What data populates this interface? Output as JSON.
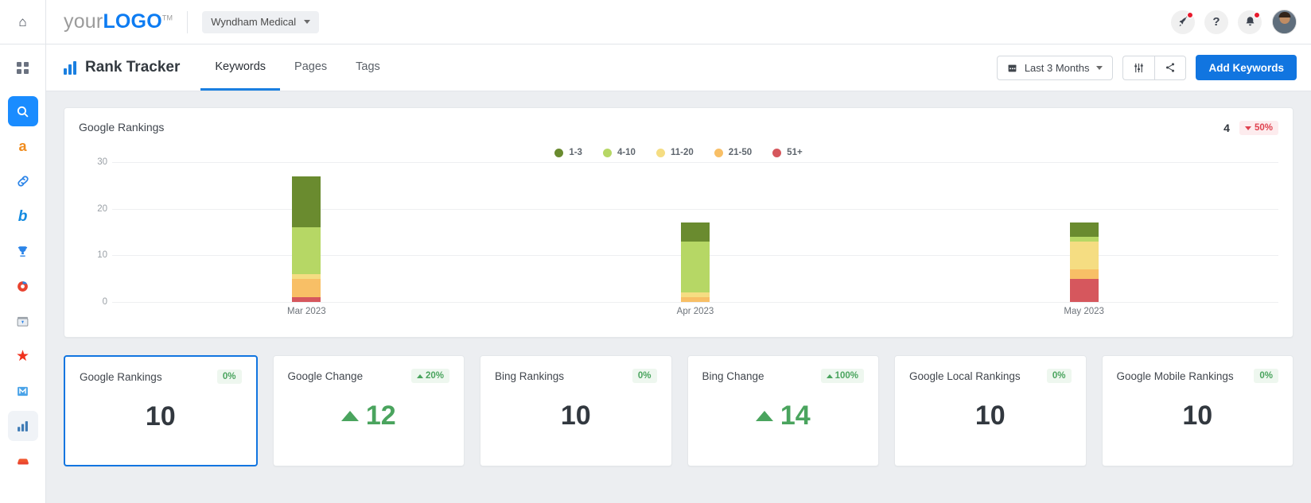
{
  "rail": {
    "items": [
      {
        "name": "home-icon",
        "glyph": "⌂"
      },
      {
        "name": "apps-grid-icon",
        "glyph": "⁙"
      },
      {
        "name": "search-icon",
        "glyph": "🔍",
        "active": true
      },
      {
        "name": "amazon-icon",
        "glyph": "a"
      },
      {
        "name": "link-icon",
        "glyph": "🔗"
      },
      {
        "name": "bing-icon",
        "glyph": "b"
      },
      {
        "name": "trophy-icon",
        "glyph": "🏆"
      },
      {
        "name": "globe-icon",
        "glyph": "🌐"
      },
      {
        "name": "store-icon",
        "glyph": "🏪"
      },
      {
        "name": "star-icon",
        "glyph": "★"
      },
      {
        "name": "mail-icon",
        "glyph": "M"
      },
      {
        "name": "chart-icon",
        "glyph": "📊",
        "soft": true
      },
      {
        "name": "car-icon",
        "glyph": "🚗"
      }
    ]
  },
  "topbar": {
    "logo_light": "your",
    "logo_bold": "LOGO",
    "logo_tm": "TM",
    "account": "Wyndham Medical",
    "rocket_title": "rocket-icon",
    "help_title": "?",
    "bell_title": "bell-icon"
  },
  "pageheader": {
    "title": "Rank Tracker",
    "tabs": [
      {
        "label": "Keywords",
        "active": true
      },
      {
        "label": "Pages",
        "active": false
      },
      {
        "label": "Tags",
        "active": false
      }
    ],
    "date_range": "Last 3 Months",
    "settings_icon": "sliders-icon",
    "share_icon": "share-icon",
    "add_keywords": "Add Keywords"
  },
  "chart_card": {
    "title": "Google Rankings",
    "total": "4",
    "change": "50%"
  },
  "chart_data": {
    "type": "bar",
    "title": "Google Rankings",
    "stacked": true,
    "categories": [
      "Mar 2023",
      "Apr 2023",
      "May 2023"
    ],
    "xlabel": "",
    "ylabel": "",
    "ylim": [
      0,
      30
    ],
    "yticks": [
      0,
      10,
      20,
      30
    ],
    "grid": true,
    "legend_position": "top-center",
    "colors": {
      "1-3": "#6a8b2f",
      "4-10": "#b6d765",
      "11-20": "#f5dd82",
      "21-50": "#f8bf66",
      "51+": "#d6575d"
    },
    "series": [
      {
        "name": "1-3",
        "values": [
          11,
          4,
          3
        ]
      },
      {
        "name": "4-10",
        "values": [
          10,
          11,
          1
        ]
      },
      {
        "name": "11-20",
        "values": [
          1,
          1,
          6
        ]
      },
      {
        "name": "21-50",
        "values": [
          4,
          1,
          2
        ]
      },
      {
        "name": "51+",
        "values": [
          1,
          0,
          5
        ]
      }
    ],
    "legend": [
      "1-3",
      "4-10",
      "11-20",
      "21-50",
      "51+"
    ]
  },
  "kpis": [
    {
      "label": "Google Rankings",
      "badge": "0%",
      "direction": "flat",
      "value": "10",
      "selected": true
    },
    {
      "label": "Google Change",
      "badge": "20%",
      "direction": "up",
      "value": "12",
      "selected": false
    },
    {
      "label": "Bing Rankings",
      "badge": "0%",
      "direction": "flat",
      "value": "10",
      "selected": false
    },
    {
      "label": "Bing Change",
      "badge": "100%",
      "direction": "up",
      "value": "14",
      "selected": false
    },
    {
      "label": "Google Local Rankings",
      "badge": "0%",
      "direction": "flat",
      "value": "10",
      "selected": false
    },
    {
      "label": "Google Mobile Rankings",
      "badge": "0%",
      "direction": "flat",
      "value": "10",
      "selected": false
    }
  ]
}
